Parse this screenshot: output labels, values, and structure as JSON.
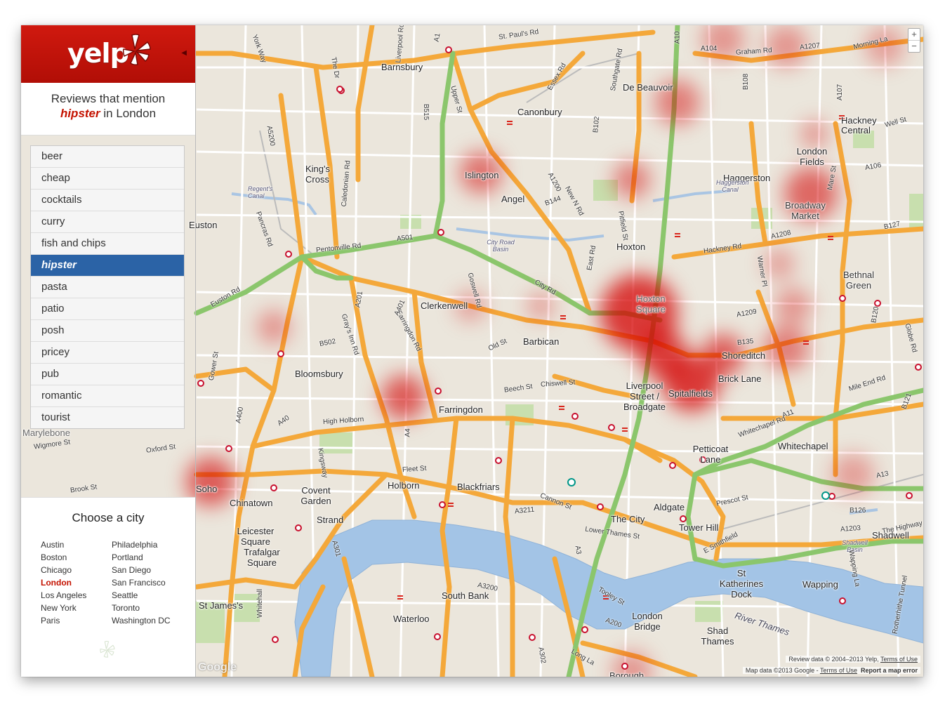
{
  "brand": {
    "logo_text": "yelp",
    "accent_color": "#c41200",
    "header_color": "#c8150c",
    "collapse_icon": "triangle-left-icon"
  },
  "title": {
    "line1": "Reviews that mention",
    "keyword": "hipster",
    "suffix": " in London"
  },
  "keywords": [
    {
      "label": "beer",
      "active": false
    },
    {
      "label": "cheap",
      "active": false
    },
    {
      "label": "cocktails",
      "active": false
    },
    {
      "label": "curry",
      "active": false
    },
    {
      "label": "fish and chips",
      "active": false
    },
    {
      "label": "hipster",
      "active": true
    },
    {
      "label": "pasta",
      "active": false
    },
    {
      "label": "patio",
      "active": false
    },
    {
      "label": "posh",
      "active": false
    },
    {
      "label": "pricey",
      "active": false
    },
    {
      "label": "pub",
      "active": false
    },
    {
      "label": "romantic",
      "active": false
    },
    {
      "label": "tourist",
      "active": false
    }
  ],
  "city_panel": {
    "title": "Choose a city",
    "col1": [
      "Austin",
      "Boston",
      "Chicago",
      "London",
      "Los Angeles",
      "New York",
      "Paris"
    ],
    "col2": [
      "Philadelphia",
      "Portland",
      "San Diego",
      "San Francisco",
      "Seattle",
      "Toronto",
      "Washington DC"
    ],
    "active": "London"
  },
  "map": {
    "zoom_in": "+",
    "zoom_out": "−",
    "google_logo": "Google",
    "attribution_review": "Review data © 2004–2013 Yelp,",
    "attribution_review_link": "Terms of Use",
    "attribution_map": "Map data ©2013 Google -",
    "attribution_map_link": "Terms of Use",
    "report_error": "Report a map error",
    "heat_color": "#d40000",
    "places": [
      "Barnsbury",
      "De Beauvoir",
      "Canonbury",
      "Hackney Central",
      "King's Cross",
      "Islington",
      "London Fields",
      "Haggerston",
      "Angel",
      "Broadway Market",
      "Euston",
      "Hoxton",
      "Bethnal Green",
      "City Road Basin",
      "Regent's Canal",
      "Clerkenwell",
      "Hoxton Square",
      "Barbican",
      "Shoreditch",
      "Bloomsbury",
      "Brick Lane",
      "Liverpool Street / Broadgate",
      "Spitalfields",
      "Farringdon",
      "Marylebone",
      "Petticoat Lane",
      "Whitechapel",
      "Soho",
      "Covent Garden",
      "Holborn",
      "Blackfriars",
      "Chinatown",
      "Aldgate",
      "Leicester Square",
      "Strand",
      "The City",
      "Tower Hill",
      "Shadwell",
      "Trafalgar Square",
      "St Katherines Dock",
      "Wapping",
      "South Bank",
      "St James's",
      "Waterloo",
      "London Bridge",
      "Shad Thames",
      "River Thames",
      "Borough",
      "Shadwell Basin",
      "Haggerston Canal"
    ],
    "roads": [
      "St. Paul's Rd",
      "A104",
      "Graham Rd",
      "A1207",
      "Morning La",
      "Essex Rd",
      "Southgate Rd",
      "Upper St",
      "B515",
      "A1",
      "A10",
      "B108",
      "A107",
      "Well St",
      "York Way",
      "The Dr",
      "Liverpool Rd",
      "A5200",
      "Caledonian Rd",
      "B102",
      "A106",
      "A1200",
      "New N Rd",
      "B144",
      "Pitfield St",
      "Mare St",
      "Pancras Rd",
      "Pentonville Rd",
      "A501",
      "East Rd",
      "Hackney Rd",
      "A1208",
      "Warner Pl",
      "B127",
      "Euston Rd",
      "Goswell Rd",
      "City Rd",
      "A1209",
      "Gray's Inn Rd",
      "Farringdon Rd",
      "A201",
      "A401",
      "B502",
      "Old St",
      "B135",
      "B120",
      "Globe Rd",
      "Gower St",
      "Chiswell St",
      "Beech St",
      "Mile End Rd",
      "A400",
      "A40",
      "High Holborn",
      "Whitechapel Rd",
      "A11",
      "B121",
      "Wigmore St",
      "Oxford St",
      "A4",
      "Kingsway",
      "Prescot St",
      "A13",
      "Fleet St",
      "Cannon St",
      "A3211",
      "Lower Thames St",
      "B126",
      "The Highway",
      "A1203",
      "E Smithfield",
      "A301",
      "A3200",
      "Tooley St",
      "A200",
      "Wapping La",
      "Rotherhithe Tunnel",
      "Whitehall",
      "Long La",
      "A302",
      "A3",
      "Brook St"
    ]
  }
}
